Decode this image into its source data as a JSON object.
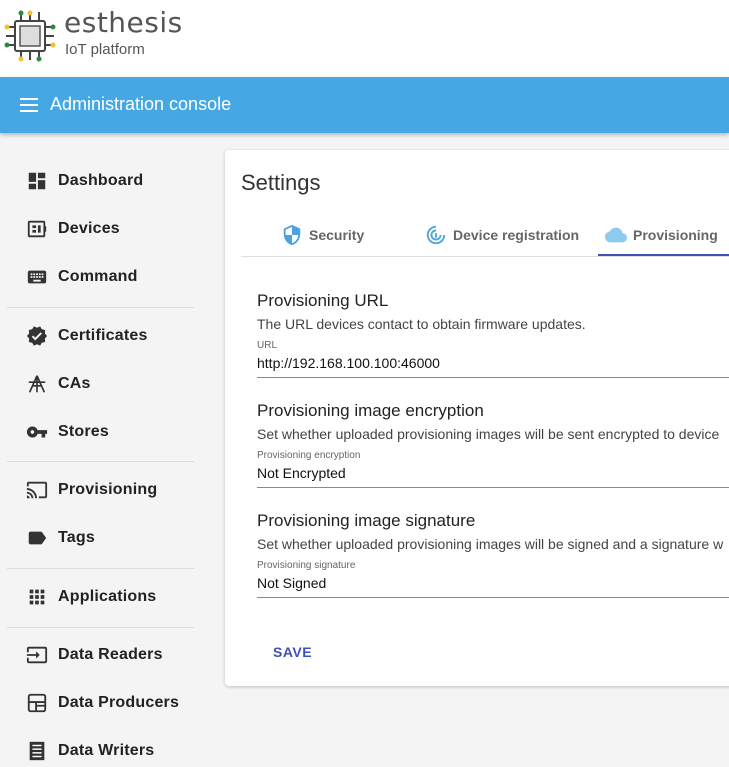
{
  "brand": {
    "name": "esthesis",
    "subtitle": "IoT platform"
  },
  "appbar": {
    "title": "Administration console",
    "menu_icon": "hamburger-menu-icon"
  },
  "sidebar": {
    "items": [
      {
        "label": "Dashboard",
        "icon": "dashboard-icon"
      },
      {
        "label": "Devices",
        "icon": "devices-icon"
      },
      {
        "label": "Command",
        "icon": "keyboard-icon"
      },
      {
        "label": "Certificates",
        "icon": "verified-badge-icon"
      },
      {
        "label": "CAs",
        "icon": "tower-icon"
      },
      {
        "label": "Stores",
        "icon": "key-icon"
      },
      {
        "label": "Provisioning",
        "icon": "cast-icon"
      },
      {
        "label": "Tags",
        "icon": "label-tag-icon"
      },
      {
        "label": "Applications",
        "icon": "apps-grid-icon"
      },
      {
        "label": "Data Readers",
        "icon": "input-icon"
      },
      {
        "label": "Data Producers",
        "icon": "dashboard-frame-icon"
      },
      {
        "label": "Data Writers",
        "icon": "list-document-icon"
      }
    ]
  },
  "settings": {
    "title": "Settings",
    "tabs": [
      {
        "label": "Security",
        "icon": "shield-icon",
        "active": false
      },
      {
        "label": "Device registration",
        "icon": "fingerprint-icon",
        "active": false
      },
      {
        "label": "Provisioning",
        "icon": "cloud-icon",
        "active": true
      }
    ],
    "sections": [
      {
        "title": "Provisioning URL",
        "description": "The URL devices contact to obtain firmware updates.",
        "field_label": "URL",
        "field_value": "http://192.168.100.100:46000"
      },
      {
        "title": "Provisioning image encryption",
        "description": "Set whether uploaded provisioning images will be sent encrypted to device",
        "field_label": "Provisioning encryption",
        "field_value": "Not Encrypted"
      },
      {
        "title": "Provisioning image signature",
        "description": "Set whether uploaded provisioning images will be signed and a signature w",
        "field_label": "Provisioning signature",
        "field_value": "Not Signed"
      }
    ],
    "save_label": "SAVE"
  },
  "colors": {
    "appbar": "#45a7e4",
    "accent": "#3f51b5",
    "tab_icon": "#4aa3df"
  }
}
